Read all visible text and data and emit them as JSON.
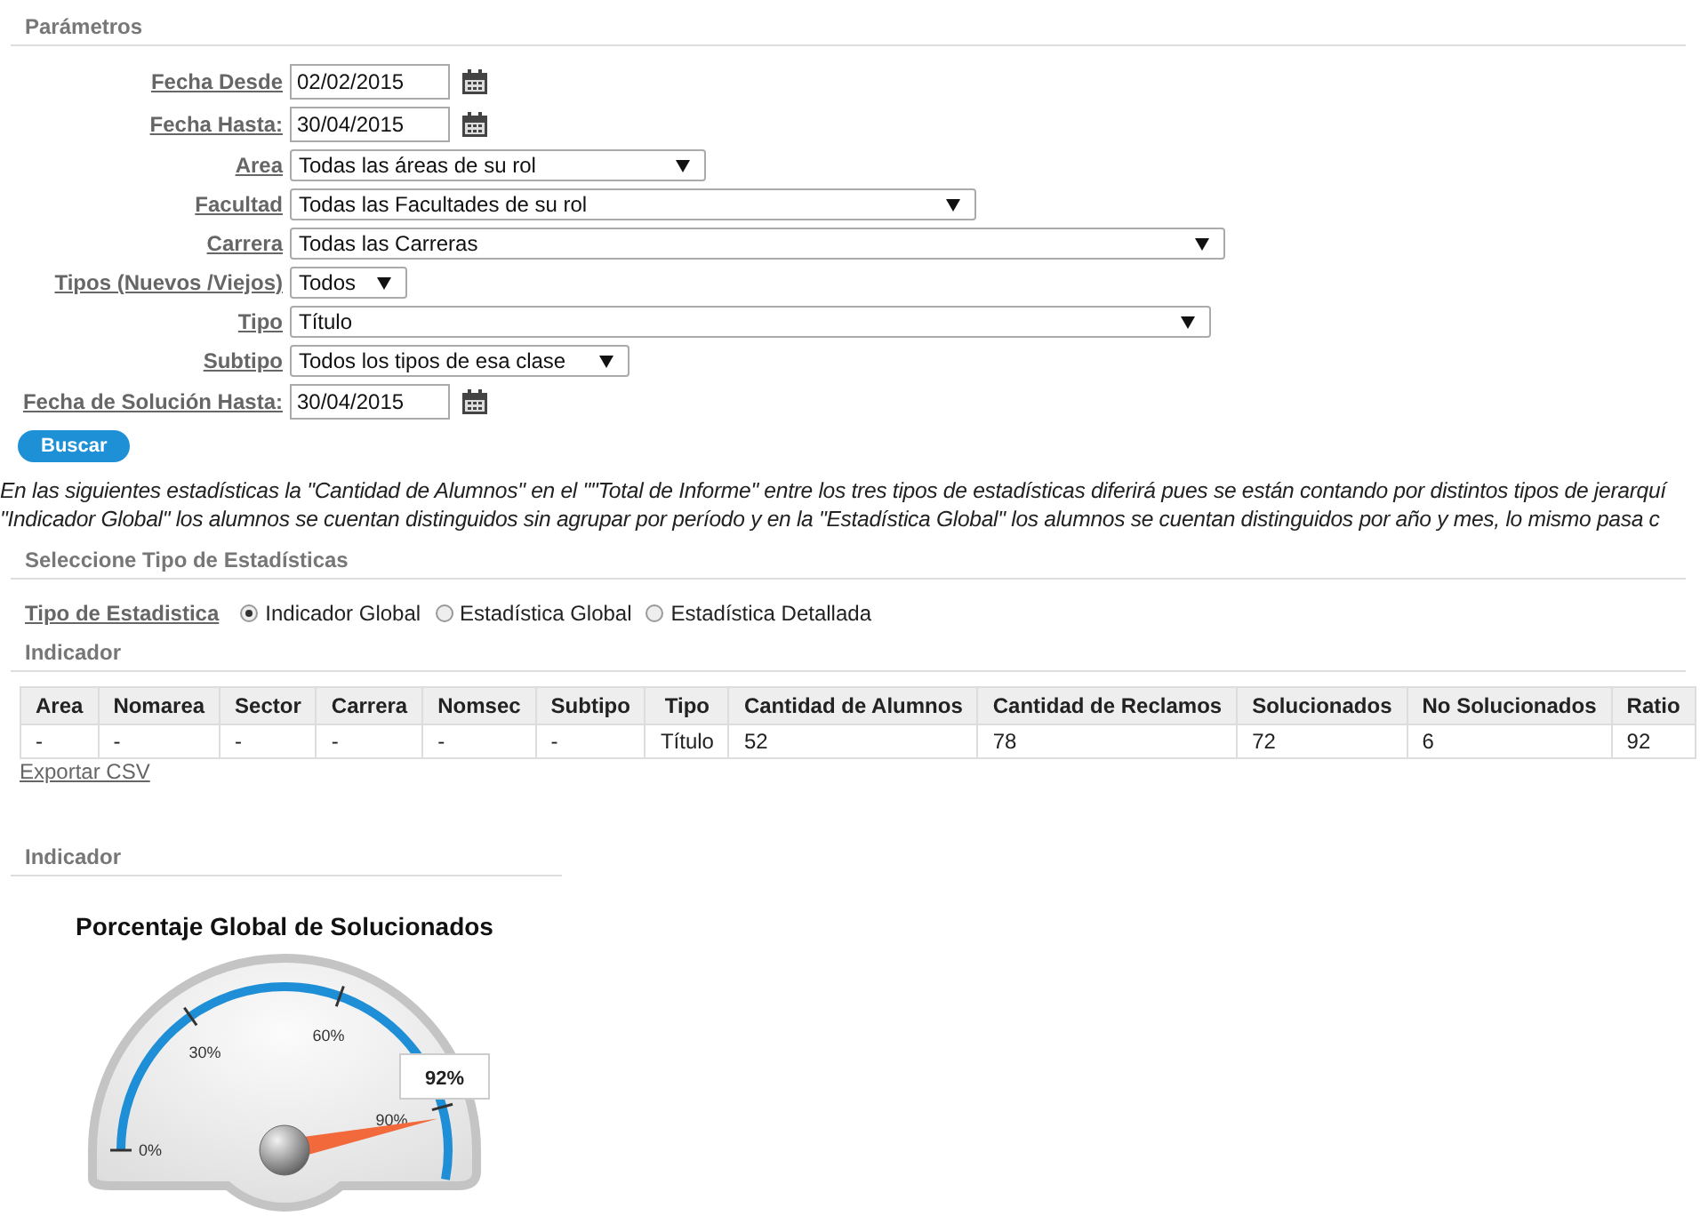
{
  "parametros": {
    "title": "Parámetros",
    "fields": [
      {
        "kind": "date",
        "label": "Fecha Desde",
        "value": "02/02/2015"
      },
      {
        "kind": "date",
        "label": "Fecha Hasta:",
        "value": "30/04/2015"
      },
      {
        "kind": "select",
        "label": "Area",
        "value": "Todas las áreas de su rol"
      },
      {
        "kind": "select",
        "label": "Facultad",
        "value": "Todas las Facultades de su rol"
      },
      {
        "kind": "select",
        "label": "Carrera",
        "value": "Todas las Carreras"
      },
      {
        "kind": "select",
        "label": "Tipos (Nuevos /Viejos)",
        "value": "Todos"
      },
      {
        "kind": "select",
        "label": "Tipo",
        "value": "Título"
      },
      {
        "kind": "select",
        "label": "Subtipo",
        "value": "Todos los tipos de esa clase"
      },
      {
        "kind": "date",
        "label": "Fecha de Solución Hasta:",
        "value": "30/04/2015"
      }
    ],
    "button": "Buscar"
  },
  "note": [
    "En las siguientes estadísticas la \"Cantidad de Alumnos\" en el \"\"Total de Informe\" entre los tres tipos de estadísticas diferirá pues se están contando por distintos tipos de jerarquí",
    "\"Indicador Global\" los alumnos se cuentan distinguidos sin agrupar por período y en la \"Estadística Global\" los alumnos se cuentan distinguidos por año y mes, lo mismo pasa c"
  ],
  "tipo_estadistica": {
    "title": "Seleccione Tipo de Estadísticas",
    "label": "Tipo de Estadistica",
    "options": [
      {
        "label": "Indicador Global",
        "selected": true
      },
      {
        "label": "Estadística Global",
        "selected": false
      },
      {
        "label": "Estadística Detallada",
        "selected": false
      }
    ]
  },
  "indicador_table": {
    "title": "Indicador",
    "columns": [
      "Area",
      "Nomarea",
      "Sector",
      "Carrera",
      "Nomsec",
      "Subtipo",
      "Tipo",
      "Cantidad de Alumnos",
      "Cantidad de Reclamos",
      "Solucionados",
      "No Solucionados",
      "Ratio"
    ],
    "rows": [
      [
        "-",
        "-",
        "-",
        "-",
        "-",
        "-",
        "Título",
        "52",
        "78",
        "72",
        "6",
        "92"
      ]
    ],
    "export_link": "Exportar CSV"
  },
  "indicador_gauge": {
    "title": "Indicador",
    "gauge_title": "Porcentaje Global de Solucionados",
    "ticks": [
      "0%",
      "30%",
      "60%",
      "90%"
    ],
    "value_label": "92%",
    "level": 0.92
  }
}
